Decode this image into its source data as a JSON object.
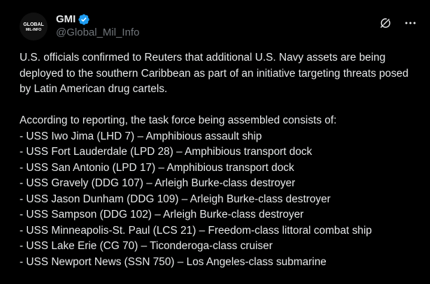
{
  "author": {
    "display_name": "GMI",
    "handle": "@Global_Mil_Info",
    "avatar_text_top": "GLOBAL",
    "avatar_text_bottom": "MIL-INFO",
    "verified_color": "#1d9bf0"
  },
  "icons": {
    "grok": "grok-icon",
    "more": "more-options-icon",
    "verified": "verified-badge-icon"
  },
  "post": {
    "paragraph1": "U.S. officials confirmed to Reuters that additional U.S. Navy assets are being deployed to the southern Caribbean as part of an initiative targeting threats posed by Latin American drug cartels.",
    "paragraph2": "According to reporting, the task force being assembled consists of:",
    "ships": [
      "- USS Iwo Jima (LHD 7) – Amphibious assault ship",
      "- USS Fort Lauderdale (LPD 28) – Amphibious transport dock",
      "- USS San Antonio (LPD 17) – Amphibious transport dock",
      "- USS Gravely (DDG 107) – Arleigh Burke-class destroyer",
      "- USS Jason Dunham (DDG 109) – Arleigh Burke-class destroyer",
      "- USS Sampson (DDG 102) – Arleigh Burke-class destroyer",
      "- USS Minneapolis-St. Paul (LCS 21) – Freedom-class littoral combat ship",
      "- USS Lake Erie (CG 70) – Ticonderoga-class cruiser",
      "- USS Newport News (SSN 750) – Los Angeles-class submarine"
    ]
  },
  "colors": {
    "background": "#000000",
    "text": "#e7e9ea",
    "muted": "#71767b"
  }
}
